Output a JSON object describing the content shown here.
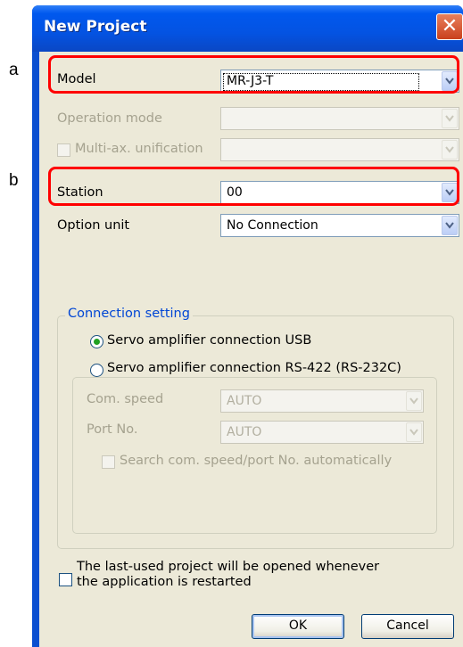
{
  "callouts": {
    "a": "a",
    "b": "b"
  },
  "dialog": {
    "title": "New Project",
    "close_glyph": "✕"
  },
  "form": {
    "model": {
      "label": "Model",
      "value": "MR-J3-T"
    },
    "operation_mode": {
      "label": "Operation mode",
      "value": ""
    },
    "multi_axis": {
      "label": "Multi-ax. unification",
      "value": ""
    },
    "station": {
      "label": "Station",
      "value": "00"
    },
    "option_unit": {
      "label": "Option unit",
      "value": "No Connection"
    }
  },
  "connection": {
    "group_title": "Connection setting",
    "radio_usb": {
      "label": "Servo amplifier connection USB",
      "selected": true
    },
    "radio_rs422": {
      "label": "Servo amplifier connection RS-422 (RS-232C)",
      "selected": false
    },
    "com_speed": {
      "label": "Com. speed",
      "value": "AUTO"
    },
    "port_no": {
      "label": "Port No.",
      "value": "AUTO"
    },
    "auto_search": {
      "label": "Search com. speed/port No. automatically",
      "checked": false
    }
  },
  "last_used": {
    "line1": "The last-used project will be opened whenever",
    "line2": "the application is restarted",
    "checked": false
  },
  "buttons": {
    "ok": "OK",
    "cancel": "Cancel"
  },
  "colors": {
    "title_bar": "#0058ee",
    "client_bg": "#ece9d8",
    "highlight": "#ff0000",
    "group_title": "#0046d5",
    "radio_dot": "#21a121"
  },
  "icons": [
    "close-icon",
    "chevron-down-icon",
    "radio-selected-icon",
    "radio-empty-icon",
    "checkbox-icon"
  ]
}
